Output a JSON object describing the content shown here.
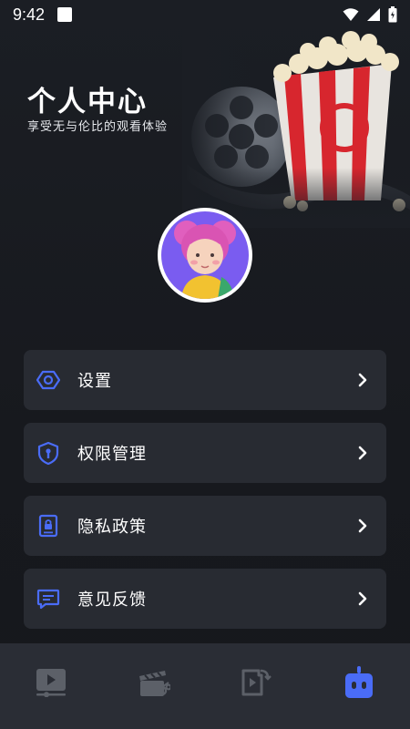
{
  "status_bar": {
    "time": "9:42",
    "icons": [
      "wifi-icon",
      "signal-icon",
      "battery-icon"
    ]
  },
  "header": {
    "title": "个人中心",
    "subtitle": "享受无与伦比的观看体验"
  },
  "menu": {
    "items": [
      {
        "label": "设置",
        "icon": "gear-icon"
      },
      {
        "label": "权限管理",
        "icon": "shield-icon"
      },
      {
        "label": "隐私政策",
        "icon": "lock-document-icon"
      },
      {
        "label": "意见反馈",
        "icon": "message-icon"
      }
    ]
  },
  "bottom_nav": {
    "tabs": [
      {
        "icon": "video-play-icon",
        "active": false
      },
      {
        "icon": "clapperboard-cut-icon",
        "active": false
      },
      {
        "icon": "media-share-icon",
        "active": false
      },
      {
        "icon": "robot-icon",
        "active": true
      }
    ]
  },
  "colors": {
    "background": "#17191e",
    "card": "#282b32",
    "accent": "#4a6cf7",
    "nav_bar": "#2a2d35",
    "inactive_icon": "#5c6068"
  }
}
